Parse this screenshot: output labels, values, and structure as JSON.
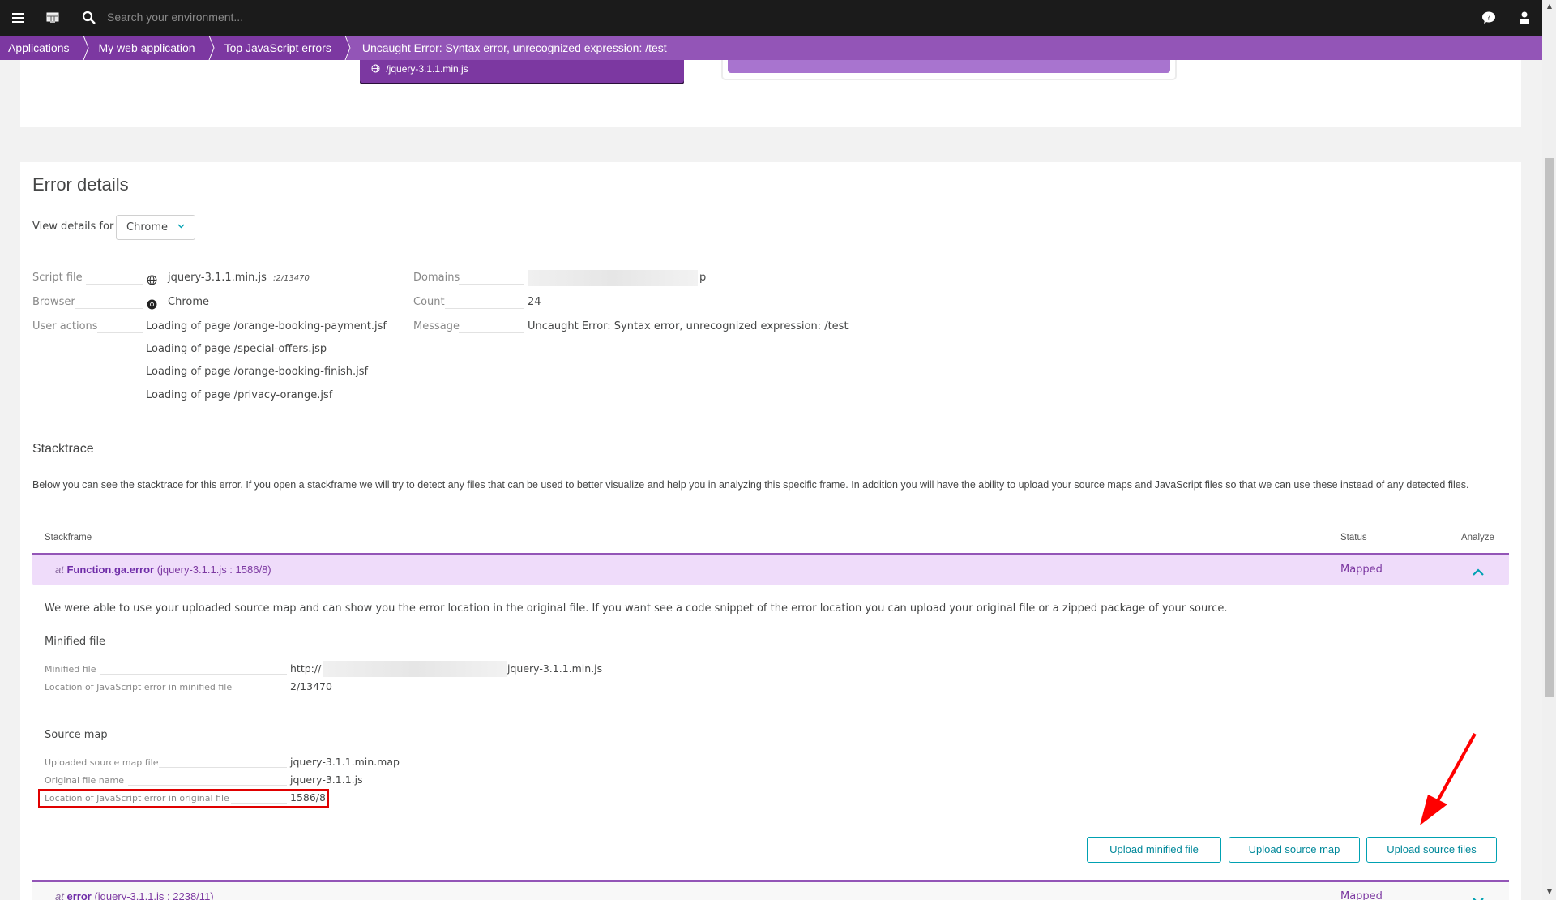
{
  "topbar": {
    "search_placeholder": "Search your environment...",
    "icons": [
      "menu-icon",
      "dashboard-icon",
      "search-icon",
      "help-chat-icon",
      "user-icon"
    ]
  },
  "breadcrumb": [
    {
      "label": "Applications"
    },
    {
      "label": "My web application"
    },
    {
      "label": "Top JavaScript errors"
    },
    {
      "label": "Uncaught Error: Syntax error, unrecognized expression: /test"
    }
  ],
  "top_strip": {
    "file_label": "/jquery-3.1.1.min.js"
  },
  "error_details": {
    "title": "Error details",
    "view_for_label": "View details for",
    "view_for_value": "Chrome",
    "left": {
      "script_file_label": "Script file",
      "script_file_value": "jquery-3.1.1.min.js",
      "script_file_location": ":2/13470",
      "browser_label": "Browser",
      "browser_value": "Chrome",
      "user_actions_label": "User actions",
      "user_actions": [
        "Loading of page /orange-booking-payment.jsf",
        "Loading of page /special-offers.jsp",
        "Loading of page /orange-booking-finish.jsf",
        "Loading of page /privacy-orange.jsf"
      ]
    },
    "right": {
      "domains_label": "Domains",
      "domains_value_suffix": "p",
      "count_label": "Count",
      "count_value": "24",
      "message_label": "Message",
      "message_value": "Uncaught Error: Syntax error, unrecognized expression: /test"
    }
  },
  "stacktrace": {
    "title": "Stacktrace",
    "description": "Below you can see the stacktrace for this error. If you open a stackframe we will try to detect any files that can be used to better visualize and help you in analyzing this specific frame. In addition you will have the ability to upload your source maps and JavaScript files so that we can use these instead of any detected files.",
    "columns": {
      "stackframe": "Stackframe",
      "status": "Status",
      "analyze": "Analyze"
    },
    "frames": [
      {
        "at": "at",
        "function": "Function.ga.error",
        "location": "(jquery-3.1.1.js : 1586/8)",
        "status": "Mapped",
        "expanded": true
      },
      {
        "at": "at",
        "function": "error",
        "location": "(jquery-3.1.1.js : 2238/11)",
        "status": "Mapped",
        "expanded": false
      }
    ],
    "expanded": {
      "explanation": "We were able to use your uploaded source map and can show you the error location in the original file. If you want see a code snippet of the error location you can upload your original file or a zipped package of your source.",
      "minified_heading": "Minified file",
      "minified_file_label": "Minified file",
      "minified_file_prefix": "http://",
      "minified_file_suffix": "jquery-3.1.1.min.js",
      "minified_location_label": "Location of JavaScript error in minified file",
      "minified_location_value": "2/13470",
      "source_map_heading": "Source map",
      "uploaded_map_label": "Uploaded source map file",
      "uploaded_map_value": "jquery-3.1.1.min.map",
      "original_name_label": "Original file name",
      "original_name_value": "jquery-3.1.1.js",
      "original_location_label": "Location of JavaScript error in original file",
      "original_location_value": "1586/8"
    },
    "buttons": {
      "upload_minified": "Upload minified file",
      "upload_source_map": "Upload source map",
      "upload_source_files": "Upload source files"
    }
  },
  "colors": {
    "topbar": "#1b1b1b",
    "breadcrumb": "#7c38a1",
    "breadcrumb_active": "#9355b7",
    "accent_teal": "#00a1b2",
    "highlight_row": "#efdcfa",
    "annotation_red": "#e00000"
  }
}
